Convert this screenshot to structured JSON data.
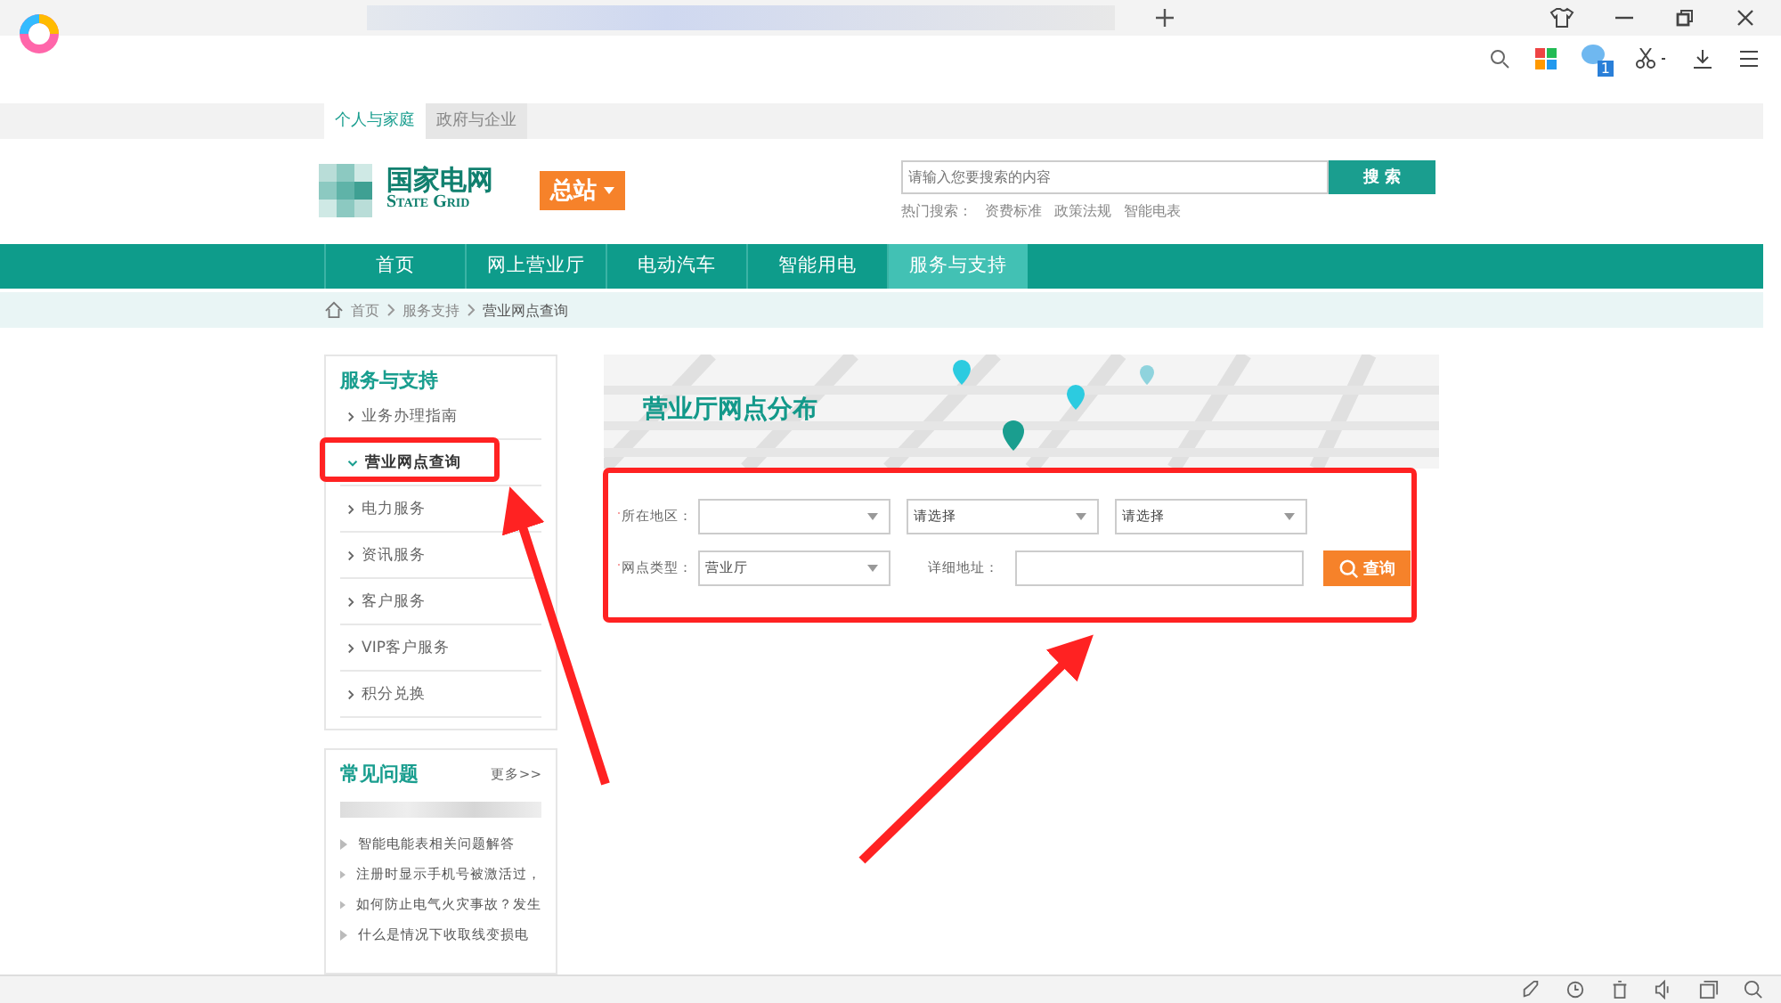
{
  "browser": {
    "notification_badge": "1"
  },
  "site_tabs": [
    {
      "label": "个人与家庭",
      "selected": true
    },
    {
      "label": "政府与企业",
      "selected": false
    }
  ],
  "header": {
    "logo_cn": "国家电网",
    "logo_en": "State Grid",
    "station": "总站",
    "search_placeholder": "请输入您要搜索的内容",
    "search_button": "搜 索",
    "hot_label": "热门搜索：",
    "hot_terms": [
      "资费标准",
      "政策法规",
      "智能电表"
    ]
  },
  "nav": [
    {
      "label": "首页",
      "selected": false
    },
    {
      "label": "网上营业厅",
      "selected": false
    },
    {
      "label": "电动汽车",
      "selected": false
    },
    {
      "label": "智能用电",
      "selected": false
    },
    {
      "label": "服务与支持",
      "selected": true
    }
  ],
  "breadcrumb": [
    "首页",
    "服务支持",
    "营业网点查询"
  ],
  "sidebar": {
    "title": "服务与支持",
    "items": [
      {
        "label": "业务办理指南",
        "selected": false
      },
      {
        "label": "营业网点查询",
        "selected": true
      },
      {
        "label": "电力服务",
        "selected": false
      },
      {
        "label": "资讯服务",
        "selected": false
      },
      {
        "label": "客户服务",
        "selected": false
      },
      {
        "label": "VIP客户服务",
        "selected": false
      },
      {
        "label": "积分兑换",
        "selected": false
      }
    ]
  },
  "faq": {
    "title": "常见问题",
    "more": "更多>>",
    "items": [
      "智能电能表相关问题解答",
      "注册时显示手机号被激活过，",
      "如何防止电气火灾事故？发生",
      "什么是情况下收取线变损电"
    ]
  },
  "banner": {
    "title": "营业厅网点分布"
  },
  "form": {
    "rows": [
      {
        "label": "所在地区：",
        "required": true,
        "fields": [
          {
            "kind": "select"
          },
          {
            "kind": "select",
            "value": "请选择"
          },
          {
            "kind": "select",
            "value": "请选择"
          }
        ]
      },
      {
        "label": "网点类型：",
        "required": true,
        "fields": [
          {
            "kind": "select",
            "value": "营业厅"
          },
          {
            "kind": "label",
            "value": "详细地址："
          },
          {
            "kind": "input"
          },
          {
            "kind": "button",
            "value": "查询"
          }
        ]
      }
    ]
  }
}
